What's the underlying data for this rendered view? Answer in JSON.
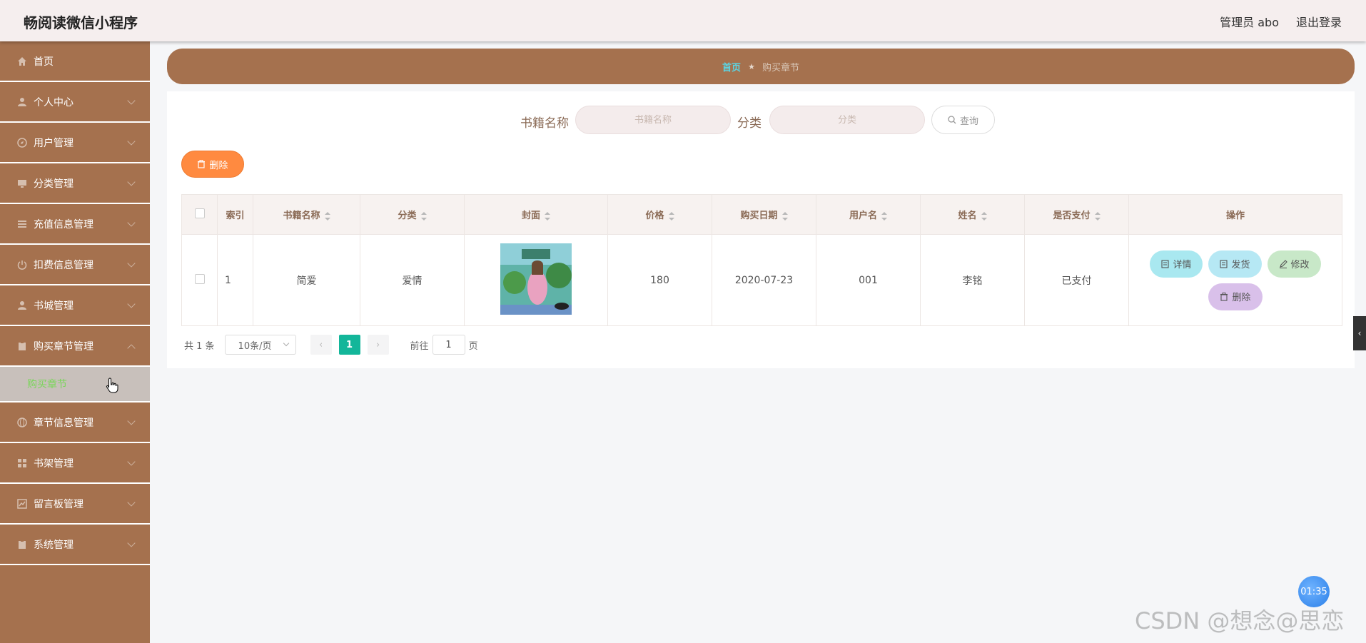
{
  "header": {
    "app_title": "畅阅读微信小程序",
    "admin_label": "管理员 abo",
    "logout_label": "退出登录"
  },
  "sidebar": {
    "items": [
      {
        "label": "首页"
      },
      {
        "label": "个人中心"
      },
      {
        "label": "用户管理"
      },
      {
        "label": "分类管理"
      },
      {
        "label": "充值信息管理"
      },
      {
        "label": "扣费信息管理"
      },
      {
        "label": "书城管理"
      },
      {
        "label": "购买章节管理"
      },
      {
        "label": "章节信息管理"
      },
      {
        "label": "书架管理"
      },
      {
        "label": "留言板管理"
      },
      {
        "label": "系统管理"
      }
    ],
    "active_sub": "购买章节"
  },
  "breadcrumb": {
    "home": "首页",
    "current": "购买章节"
  },
  "search": {
    "book_label": "书籍名称",
    "book_placeholder": "书籍名称",
    "category_label": "分类",
    "category_placeholder": "分类",
    "query_label": "查询"
  },
  "toolbar": {
    "delete_label": "删除"
  },
  "table": {
    "headers": [
      "索引",
      "书籍名称",
      "分类",
      "封面",
      "价格",
      "购买日期",
      "用户名",
      "姓名",
      "是否支付",
      "操作"
    ],
    "rows": [
      {
        "index": "1",
        "book": "简爱",
        "category": "爱情",
        "price": "180",
        "date": "2020-07-23",
        "username": "001",
        "name": "李铭",
        "paid": "已支付"
      }
    ],
    "actions": {
      "detail": "详情",
      "ship": "发货",
      "edit": "修改",
      "delete": "删除"
    }
  },
  "pagination": {
    "total": "共 1 条",
    "page_size": "10条/页",
    "current_page": "1",
    "goto_prefix": "前往",
    "goto_value": "1",
    "goto_suffix": "页"
  },
  "timer": "01:35",
  "watermark": "CSDN @想念@思恋",
  "colors": {
    "primary": "#a5714e",
    "accent_orange": "#ff8a40",
    "pager_active": "#13b69a"
  }
}
